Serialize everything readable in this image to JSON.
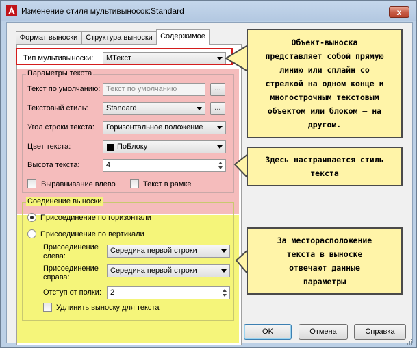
{
  "window": {
    "title": "Изменение стиля мультивыносок:Standard",
    "close_label": "x"
  },
  "tabs": [
    {
      "label": "Формат выноски",
      "active": false
    },
    {
      "label": "Структура выноски",
      "active": false
    },
    {
      "label": "Содержимое",
      "active": true
    }
  ],
  "content": {
    "multileader_type": {
      "label": "Тип мультивыноски:",
      "value": "МТекст"
    },
    "text_params": {
      "title": "Параметры текста",
      "default_text": {
        "label": "Текст по умолчанию:",
        "placeholder": "Текст по умолчанию",
        "button": "..."
      },
      "text_style": {
        "label": "Текстовый стиль:",
        "value": "Standard",
        "button": "..."
      },
      "text_angle": {
        "label": "Угол строки текста:",
        "value": "Горизонтальное положение"
      },
      "text_color": {
        "label": "Цвет текста:",
        "value": "ПоБлоку",
        "swatch": "#000000"
      },
      "text_height": {
        "label": "Высота текста:",
        "value": "4"
      },
      "left_justify": {
        "label": "Выравнивание влево",
        "checked": false
      },
      "frame_text": {
        "label": "Текст в рамке",
        "checked": false
      }
    },
    "leader_connection": {
      "title": "Соединение выноски",
      "horizontal": {
        "label": "Присоединение по горизонтали",
        "selected": true
      },
      "vertical": {
        "label": "Присоединение по вертикали",
        "selected": false
      },
      "attach_left": {
        "label_line1": "Присоединение",
        "label_line2": "слева:",
        "value": "Середина первой строки"
      },
      "attach_right": {
        "label_line1": "Присоединение",
        "label_line2": "справа:",
        "value": "Середина первой строки"
      },
      "landing_gap": {
        "label": "Отступ от полки:",
        "value": "2"
      },
      "extend_leader": {
        "label": "Удлинить выноску для текста",
        "checked": false
      }
    }
  },
  "callouts": {
    "type_note": [
      "Объект-выноска",
      "представляет собой прямую",
      "линию или сплайн со",
      "стрелкой на одном конце и",
      "многострочным текстовым",
      "объектом или блоком – на",
      "другом."
    ],
    "style_note": [
      "Здесь настраивается стиль",
      "текста"
    ],
    "position_note": [
      "За месторасположение",
      "текста в выноске",
      "отвечают данные",
      "параметры"
    ],
    "fill_color": "#fff4a8"
  },
  "buttons": {
    "ok": "OK",
    "cancel": "Отмена",
    "help": "Справка"
  },
  "colors": {
    "title_bar": "#bcd0e6",
    "red_highlight": "#f5bcbc",
    "yellow_highlight": "#f5f57a",
    "red_border": "#d41c1c"
  }
}
